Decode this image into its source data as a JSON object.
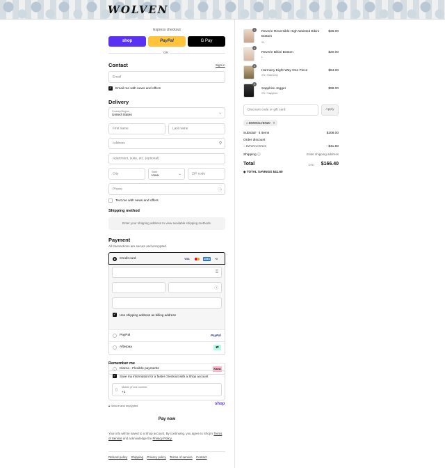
{
  "header": {
    "logo": "WOLVEN"
  },
  "express": {
    "title": "Express checkout",
    "shop_label": "shop",
    "paypal_label": "PayPal",
    "gpay_label": "G Pay",
    "or_label": "OR"
  },
  "contact": {
    "heading": "Contact",
    "signin": "Sign in",
    "email_placeholder": "Email",
    "news_label": "Email me with news and offers"
  },
  "delivery": {
    "heading": "Delivery",
    "country_label": "Country/Region",
    "country_value": "United States",
    "first_name": "First name",
    "last_name": "Last name",
    "address": "Address",
    "apartment": "Apartment, suite, etc. (optional)",
    "city": "City",
    "state_label": "State",
    "state_value": "Iowa",
    "zip": "ZIP code",
    "phone": "Phone",
    "text_label": "Text me with news and offers"
  },
  "shipping": {
    "heading": "Shipping method",
    "note": "Enter your shipping address to view available shipping methods."
  },
  "payment": {
    "heading": "Payment",
    "subtitle": "All transactions are secure and encrypted.",
    "credit_card": "Credit card",
    "card_badges": [
      "VISA",
      "MC",
      "AMEX",
      "+3"
    ],
    "billing_label": "Use shipping address as billing address",
    "paypal": "PayPal",
    "afterpay": "Afterpay",
    "klarna": "Klarna - Flexible payments",
    "klarna_badge": "Klarna"
  },
  "remember": {
    "heading": "Remember me",
    "save_label": "Save my information for a faster checkout with a Shop account",
    "phone_label": "Mobile phone number",
    "phone_value": "+1",
    "secure": "Secure and encrypted",
    "shop": "shop"
  },
  "pay_now": "Pay now",
  "legal": {
    "text1": "Your info will be saved to a Shop account. By continuing, you agree to Shop's",
    "tos": "Terms of Service",
    "text2": "and acknowledge the",
    "privacy": "Privacy Policy."
  },
  "footer_links": [
    "Refund policy",
    "Shipping",
    "Privacy policy",
    "Terms of service",
    "Contact"
  ],
  "cart": {
    "items": [
      {
        "qty": "1",
        "name": "Reverie Reversible High Waisted Bikini Bottom",
        "variant": "XL",
        "price": "$26.00"
      },
      {
        "qty": "1",
        "name": "Reverie Bikini Bottom",
        "variant": "L",
        "price": "$20.00"
      },
      {
        "qty": "1",
        "name": "Harmony Eight-Way One Piece",
        "variant": "XS / Harmony",
        "price": "$64.00"
      },
      {
        "qty": "1",
        "name": "Sapphire Jogger",
        "variant": "XS / Sapphire",
        "price": "$98.00"
      }
    ],
    "discount_placeholder": "Discount code or gift card",
    "apply": "Apply",
    "code": "BWWOLVEN20",
    "subtotal_label": "Subtotal · 4 items",
    "subtotal": "$208.00",
    "order_discount": "Order discount",
    "discount_code": "BWWOLVEN20",
    "discount_value": "- $41.60",
    "shipping_label": "Shipping",
    "shipping_value": "Enter shipping address",
    "total_label": "Total",
    "currency": "USD",
    "total": "$166.40",
    "savings_label": "TOTAL SAVINGS",
    "savings": "$41.60"
  },
  "colors": {
    "shop": "#5a31f4",
    "paypal": "#ffc439",
    "klarna": "#ffb3c7",
    "afterpay": "#b2fce4"
  }
}
